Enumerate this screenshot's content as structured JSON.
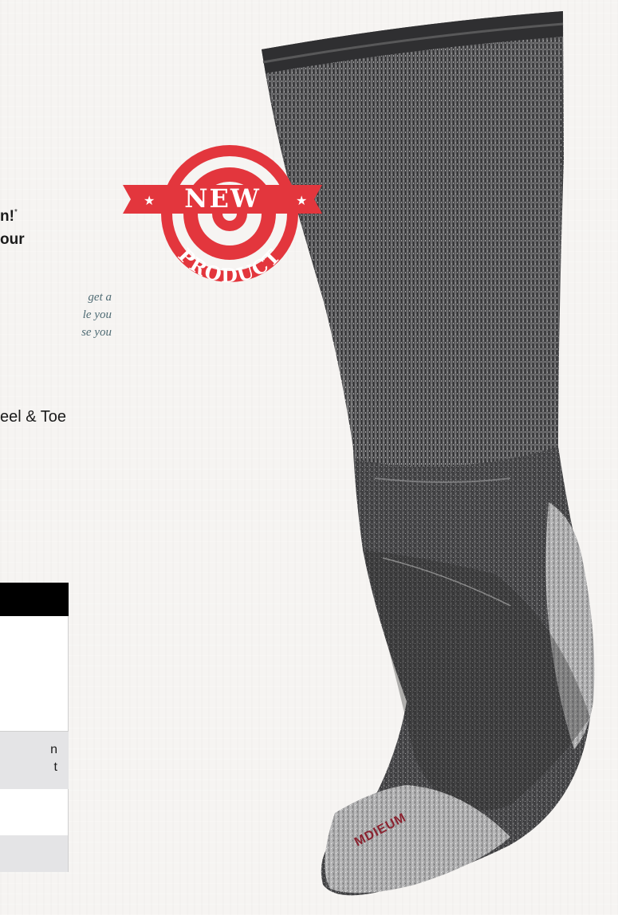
{
  "copy": {
    "headline_line1": "n!",
    "headline_mark": "*",
    "headline_line2": "our",
    "intro_lines": [
      "get a",
      "le you",
      "se you"
    ],
    "feature_text": "eel & Toe"
  },
  "table": {
    "row_fragment_1": "n",
    "row_fragment_2": "t"
  },
  "badge": {
    "top_word": "NEW",
    "bottom_word": "PRODUCT",
    "star": "★"
  },
  "product": {
    "toe_brand": "MDIEUM"
  },
  "colors": {
    "badge_red": "#e3363d",
    "sock_dark": "#3b3b3d",
    "sock_light": "#b9b9ba",
    "intro_text": "#4f6b74"
  }
}
